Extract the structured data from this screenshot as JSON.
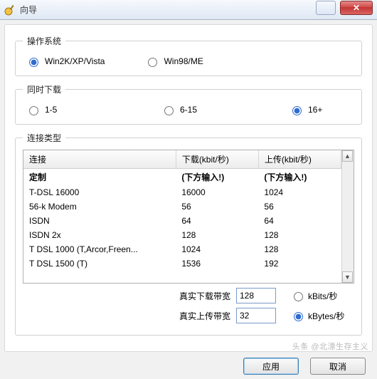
{
  "window": {
    "title": "向导",
    "close_glyph": "✕"
  },
  "os": {
    "legend": "操作系统",
    "options": [
      {
        "label": "Win2K/XP/Vista",
        "value": "vista",
        "selected": true
      },
      {
        "label": "Win98/ME",
        "value": "98",
        "selected": false
      }
    ]
  },
  "concurrent": {
    "legend": "同时下载",
    "options": [
      {
        "label": "1-5",
        "value": "a",
        "selected": false
      },
      {
        "label": "6-15",
        "value": "b",
        "selected": false
      },
      {
        "label": "16+",
        "value": "c",
        "selected": true
      }
    ]
  },
  "conn": {
    "legend": "连接类型",
    "columns": [
      "连接",
      "下载(kbit/秒)",
      "上传(kbit/秒)"
    ],
    "rows": [
      {
        "name": "定制",
        "dl": "(下方输入!)",
        "ul": "(下方输入!)"
      },
      {
        "name": "T-DSL 16000",
        "dl": "16000",
        "ul": "1024"
      },
      {
        "name": "56-k Modem",
        "dl": "56",
        "ul": "56"
      },
      {
        "name": "ISDN",
        "dl": "64",
        "ul": "64"
      },
      {
        "name": "ISDN 2x",
        "dl": "128",
        "ul": "128"
      },
      {
        "name": "T DSL 1000 (T,Arcor,Freen...",
        "dl": "1024",
        "ul": "128"
      },
      {
        "name": "T DSL 1500 (T)",
        "dl": "1536",
        "ul": "192"
      }
    ]
  },
  "bandwidth": {
    "dl_label": "真实下载带宽",
    "ul_label": "真实上传带宽",
    "dl_value": "128",
    "ul_value": "32",
    "unit_options": [
      {
        "label": "kBits/秒",
        "value": "kbits",
        "selected": false
      },
      {
        "label": "kBytes/秒",
        "value": "kbytes",
        "selected": true
      }
    ]
  },
  "buttons": {
    "apply": "应用",
    "cancel": "取消"
  },
  "watermark": "头条 @北漂生存主义"
}
